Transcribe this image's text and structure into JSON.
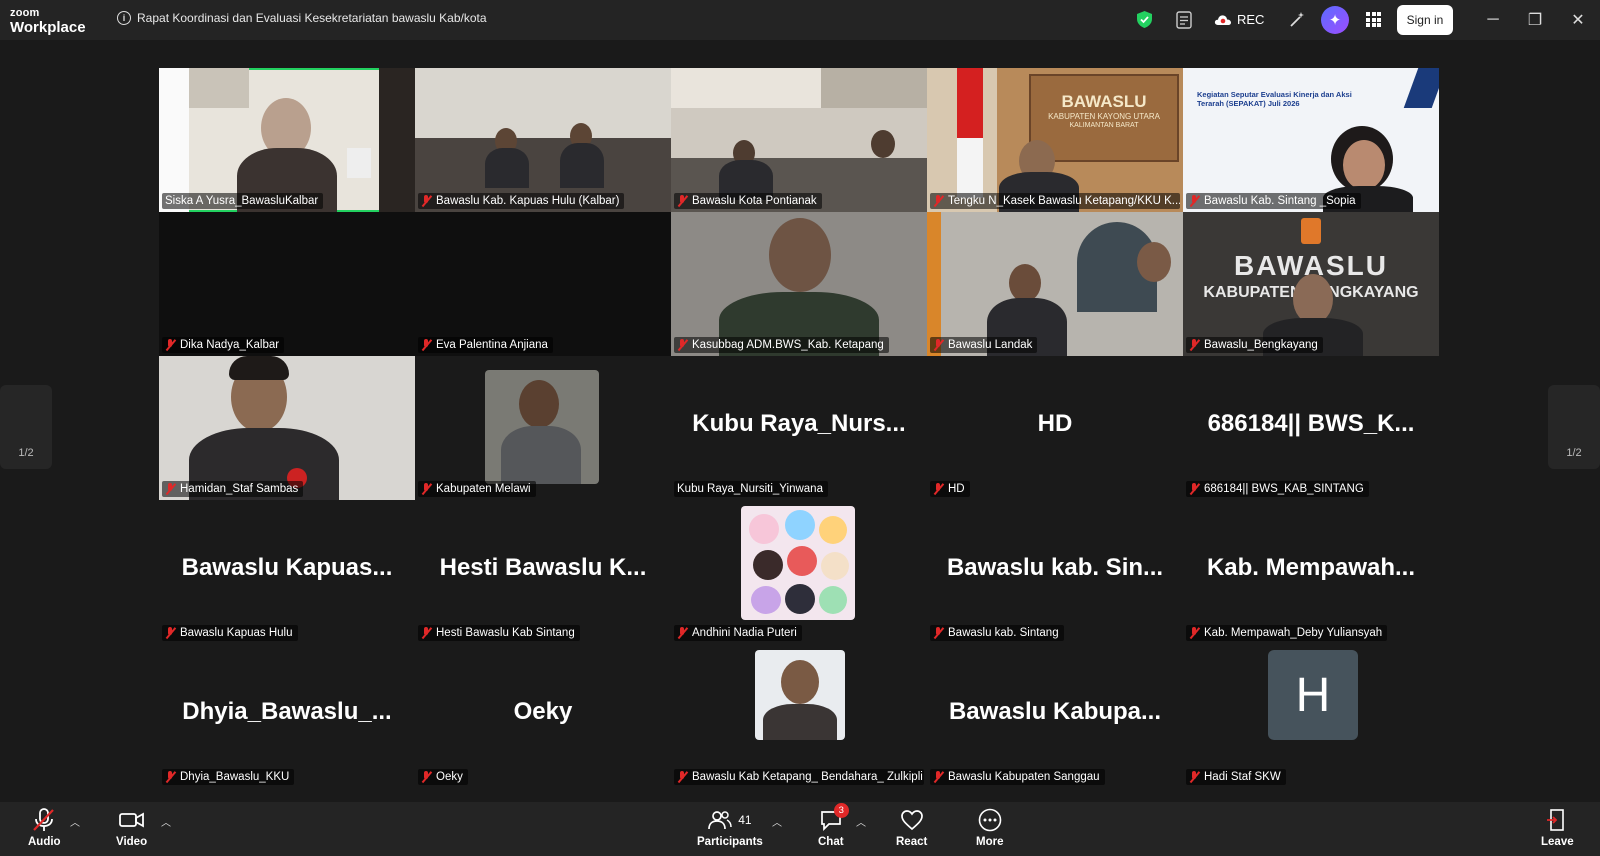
{
  "app": {
    "logo_small": "zoom",
    "logo_big": "Workplace"
  },
  "meeting": {
    "title": "Rapat Koordinasi dan Evaluasi Kesekretariatan bawaslu Kab/kota"
  },
  "titlebar": {
    "rec_label": "REC",
    "signin_label": "Sign in"
  },
  "participants": [
    {
      "name": "Siska A Yusra_BawasluKalbar",
      "active": true,
      "muted": false
    },
    {
      "name": "Bawaslu Kab. Kapuas Hulu (Kalbar)",
      "muted": true
    },
    {
      "name": "Bawaslu Kota Pontianak",
      "muted": true
    },
    {
      "name": "Tengku N_Kasek Bawaslu Ketapang/KKU K...",
      "muted": true
    },
    {
      "name": "Bawaslu Kab. Sintang _Sopia",
      "muted": true
    },
    {
      "name": "Dika Nadya_Kalbar",
      "muted": true
    },
    {
      "name": "Eva Palentina Anjiana",
      "muted": true
    },
    {
      "name": "Kasubbag ADM.BWS_Kab. Ketapang",
      "muted": true
    },
    {
      "name": "Bawaslu Landak",
      "muted": true
    },
    {
      "name": "Bawaslu_Bengkayang",
      "muted": true
    },
    {
      "name": "Hamidan_Staf Sambas",
      "muted": true
    },
    {
      "name": "Kabupaten Melawi",
      "muted": true
    },
    {
      "name": "Kubu Raya_Nursiti_Yinwana",
      "big": "Kubu  Raya_Nurs...",
      "muted": false
    },
    {
      "name": "HD",
      "big": "HD",
      "muted": true
    },
    {
      "name": "686184|| BWS_KAB_SINTANG",
      "big": "686184||  BWS_K...",
      "muted": true
    },
    {
      "name": "Bawaslu Kapuas Hulu",
      "big": "Bawaslu  Kapuas...",
      "muted": true
    },
    {
      "name": "Hesti Bawaslu Kab Sintang",
      "big": "Hesti  Bawaslu  K...",
      "muted": true
    },
    {
      "name": "Andhini Nadia Puteri",
      "muted": true
    },
    {
      "name": "Bawaslu kab. Sintang",
      "big": "Bawaslu  kab.  Sin...",
      "muted": true
    },
    {
      "name": "Kab. Mempawah_Deby Yuliansyah",
      "big": "Kab.  Mempawah...",
      "muted": true
    },
    {
      "name": "Dhyia_Bawaslu_KKU",
      "big": "Dhyia_Bawaslu_...",
      "muted": true
    },
    {
      "name": "Oeky",
      "big": "Oeky",
      "muted": true
    },
    {
      "name": "Bawaslu Kab Ketapang_ Bendahara_ Zulkipli",
      "muted": true
    },
    {
      "name": "Bawaslu Kabupaten Sanggau",
      "big": "Bawaslu  Kabupa...",
      "muted": true
    },
    {
      "name": "Hadi Staf SKW",
      "avatar_letter": "H",
      "muted": true
    }
  ],
  "tile_texts": {
    "bawaslu_kku_sign": "BAWASLU",
    "bawaslu_kku_sub": "KABUPATEN KAYONG UTARA",
    "bawaslu_kku_sub2": "KALIMANTAN BARAT",
    "sintang_banner": "Kegiatan Seputar Evaluasi Kinerja dan Aksi Terarah (SEPAKAT) Juli 2026",
    "bengkayang_sign": "BAWASLU",
    "bengkayang_sub": "KABUPATEN BENGKAYANG"
  },
  "pagination": {
    "left": "1/2",
    "right": "1/2"
  },
  "toolbar": {
    "audio": "Audio",
    "video": "Video",
    "participants": "Participants",
    "participants_count": "41",
    "chat": "Chat",
    "chat_badge": "3",
    "react": "React",
    "more": "More",
    "leave": "Leave"
  },
  "colors": {
    "active_border": "#23d160",
    "accent_blue": "#2d8cff",
    "mute_red": "#e02828"
  }
}
